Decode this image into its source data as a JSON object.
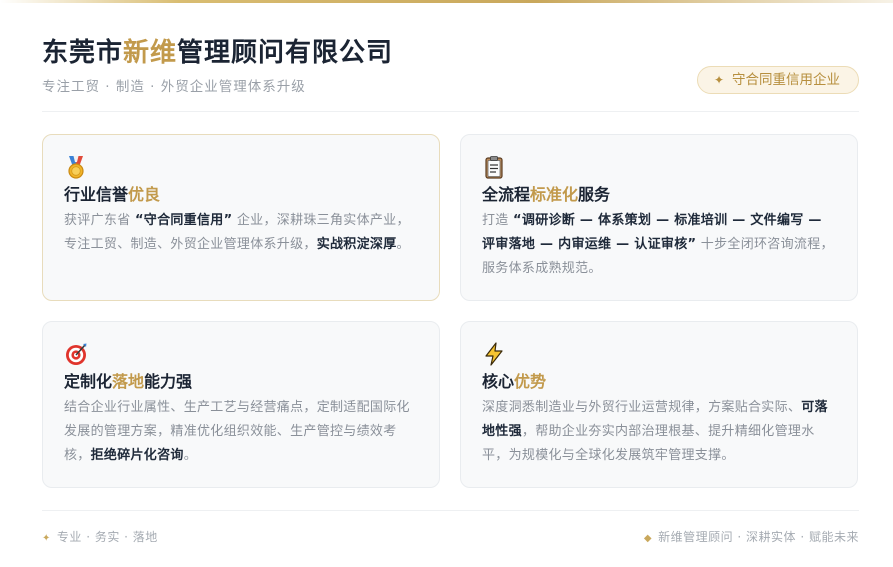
{
  "header": {
    "title_part1": "东莞市",
    "title_highlight": "新维",
    "title_part2": "管理顾问有限公司",
    "subtitle": "专注工贸 · 制造 · 外贸企业管理体系升级",
    "badge_icon": "✦",
    "badge_text": "守合同重信用企业"
  },
  "cards": [
    {
      "icon": "medal-icon",
      "title_prefix": "行业信誉",
      "title_highlight": "优良",
      "title_suffix": "",
      "body_1": "获评广东省 ",
      "body_bold_1": "“守合同重信用”",
      "body_2": " 企业，深耕珠三角实体产业，专注工贸、制造、外贸企业管理体系升级，",
      "body_bold_2": "实战积淀深厚",
      "body_3": "。"
    },
    {
      "icon": "clipboard-icon",
      "title_prefix": "全流程",
      "title_highlight": "标准化",
      "title_suffix": "服务",
      "body_1": "打造 ",
      "body_bold_1": "“调研诊断 — 体系策划 — 标准培训 — 文件编写 — 评审落地 — 内审运维 — 认证审核”",
      "body_2": " 十步全闭环咨询流程，服务体系成熟规范。",
      "body_bold_2": "",
      "body_3": ""
    },
    {
      "icon": "target-icon",
      "title_prefix": "定制化",
      "title_highlight": "落地",
      "title_suffix": "能力强",
      "body_1": "结合企业行业属性、生产工艺与经营痛点，定制适配国际化发展的管理方案，精准优化组织效能、生产管控与绩效考核，",
      "body_bold_1": "拒绝碎片化咨询",
      "body_2": "。",
      "body_bold_2": "",
      "body_3": ""
    },
    {
      "icon": "lightning-icon",
      "title_prefix": "核心",
      "title_highlight": "优势",
      "title_suffix": "",
      "body_1": "深度洞悉制造业与外贸行业运营规律，方案贴合实际、",
      "body_bold_1": "可落地性强",
      "body_2": "，帮助企业夯实内部治理根基、提升精细化管理水平，为规模化与全球化发展筑牢管理支撑。",
      "body_bold_2": "",
      "body_3": ""
    }
  ],
  "footer": {
    "left_icon": "✦",
    "left_text": "专业 · 务实 · 落地",
    "right_icon": "◆",
    "right_text": "新维管理顾问 · 深耕实体 · 赋能未来"
  },
  "colors": {
    "accent_gold": "#c29a4c",
    "badge_bg": "#fbf4e6",
    "card_bg": "#f8f9fa",
    "title_dark": "#1b2433"
  }
}
